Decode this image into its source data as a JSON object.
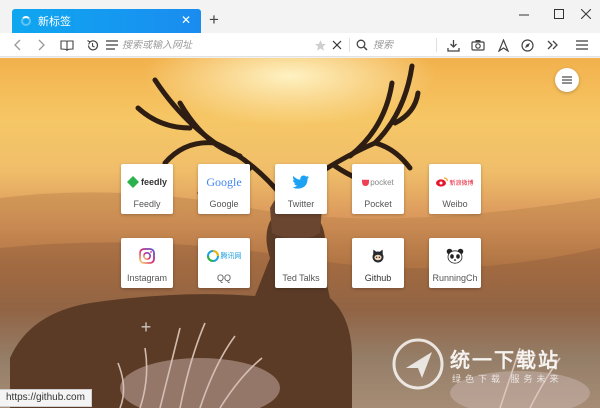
{
  "tab": {
    "title": "新标签",
    "close_glyph": "✕"
  },
  "new_tab_glyph": "+",
  "window": {
    "minimize": "minimize-icon",
    "maximize": "maximize-icon",
    "close": "close-icon"
  },
  "toolbar": {
    "url_placeholder": "搜索或输入网址",
    "url_value": "",
    "search_placeholder": "搜索",
    "search_value": ""
  },
  "speed_dial": [
    {
      "label": "Feedly",
      "logo": "feedly",
      "color": "#2bb24c"
    },
    {
      "label": "Google",
      "logo": "Google",
      "color": "#4285f4"
    },
    {
      "label": "Twitter",
      "logo": "twitter-bird",
      "color": "#1da1f2"
    },
    {
      "label": "Pocket",
      "logo": "pocket",
      "color": "#ef4056"
    },
    {
      "label": "Weibo",
      "logo": "新浪微博",
      "color": "#e6162d"
    },
    {
      "label": "Instagram",
      "logo": "instagram",
      "color": "#c13584"
    },
    {
      "label": "QQ",
      "logo": "腾讯网",
      "color": "#1aa1e1"
    },
    {
      "label": "Ted Talks",
      "logo": "",
      "color": "#e62b1e"
    },
    {
      "label": "Github",
      "logo": "octocat",
      "color": "#24292e"
    },
    {
      "label": "RunningCh",
      "logo": "panda",
      "color": "#222222"
    }
  ],
  "watermark": {
    "title": "统一下载站",
    "subtitle": "绿色下载 服务未来"
  },
  "status_url": "https://github.com"
}
